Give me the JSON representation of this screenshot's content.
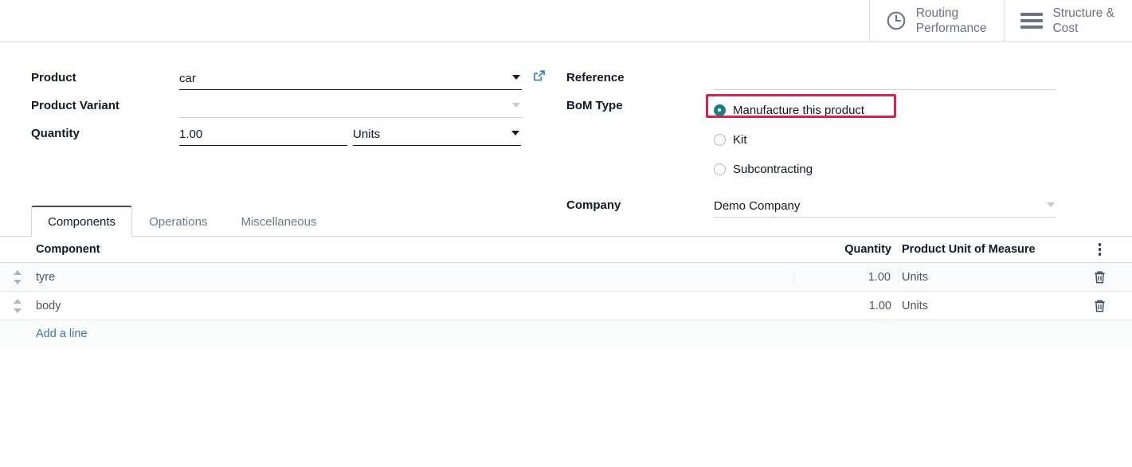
{
  "header": {
    "buttons": [
      {
        "icon": "clock-icon",
        "label": "Routing\nPerformance"
      },
      {
        "icon": "hamburger-icon",
        "label": "Structure &\nCost"
      }
    ]
  },
  "form": {
    "left": {
      "product_label": "Product",
      "product_value": "car",
      "product_variant_label": "Product Variant",
      "product_variant_value": "",
      "quantity_label": "Quantity",
      "quantity_value": "1.00",
      "uom_value": "Units"
    },
    "right": {
      "reference_label": "Reference",
      "reference_value": "",
      "bom_type_label": "BoM Type",
      "bom_type_options": [
        {
          "label": "Manufacture this product",
          "selected": true,
          "highlighted": true
        },
        {
          "label": "Kit",
          "selected": false,
          "highlighted": false
        },
        {
          "label": "Subcontracting",
          "selected": false,
          "highlighted": false
        }
      ],
      "company_label": "Company",
      "company_value": "Demo Company"
    }
  },
  "notebook": {
    "tabs": [
      {
        "label": "Components",
        "active": true
      },
      {
        "label": "Operations",
        "active": false
      },
      {
        "label": "Miscellaneous",
        "active": false
      }
    ]
  },
  "table": {
    "columns": [
      "Component",
      "Quantity",
      "Product Unit of Measure"
    ],
    "rows": [
      {
        "component": "tyre",
        "quantity": "1.00",
        "uom": "Units"
      },
      {
        "component": "body",
        "quantity": "1.00",
        "uom": "Units"
      }
    ],
    "add_line_label": "Add a line"
  },
  "colors": {
    "radio_selected": "#1a7f84",
    "highlight_border": "#d6254a",
    "link": "#3f77a8",
    "muted_text": "#6b7280"
  }
}
